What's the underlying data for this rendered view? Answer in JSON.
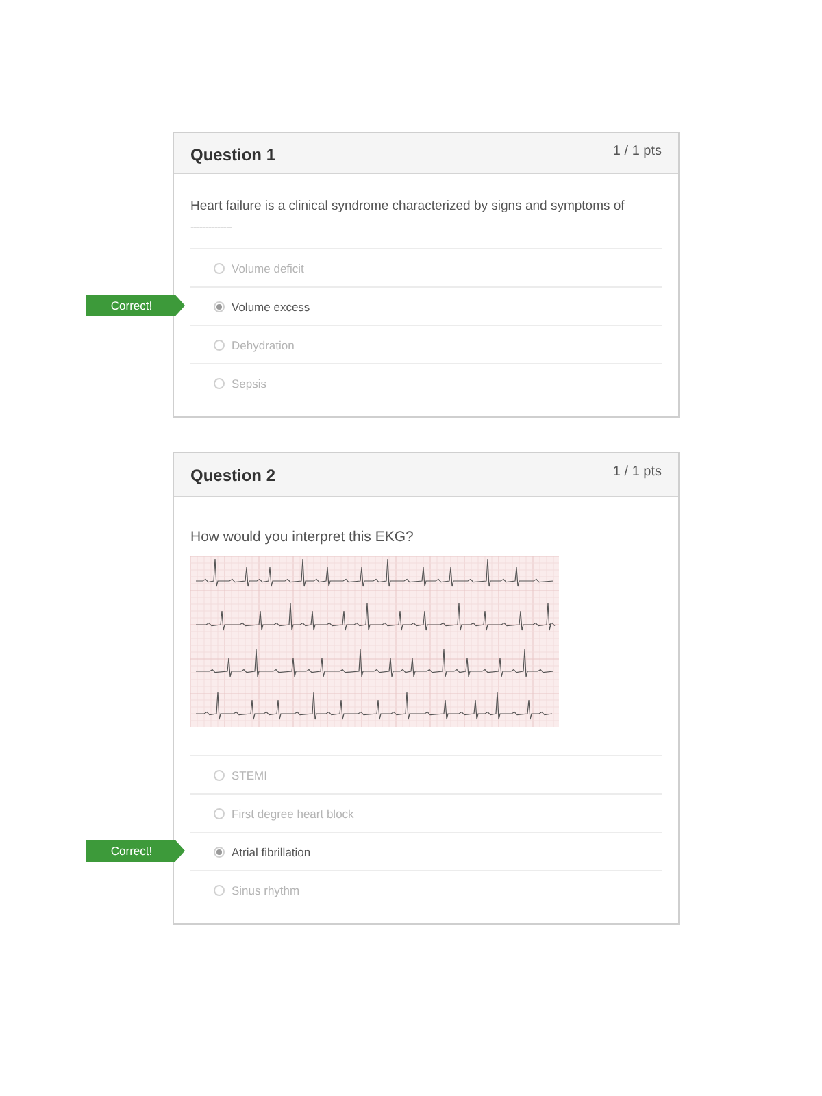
{
  "questions": [
    {
      "title": "Question 1",
      "points": "1 / 1 pts",
      "prompt": "Heart failure is a clinical syndrome characterized by signs and symptoms of",
      "blank": "--------------",
      "answers": [
        {
          "label": "Volume deficit",
          "selected": false
        },
        {
          "label": "Volume excess",
          "selected": true,
          "flag": "Correct!"
        },
        {
          "label": "Dehydration",
          "selected": false
        },
        {
          "label": "Sepsis",
          "selected": false
        }
      ]
    },
    {
      "title": "Question 2",
      "points": "1 / 1 pts",
      "prompt": "How would you interpret this EKG?",
      "figure": true,
      "answers": [
        {
          "label": "STEMI",
          "selected": false
        },
        {
          "label": "First degree heart block",
          "selected": false
        },
        {
          "label": "Atrial fibrillation",
          "selected": true,
          "flag": "Correct!"
        },
        {
          "label": "Sinus rhythm",
          "selected": false
        }
      ]
    }
  ]
}
